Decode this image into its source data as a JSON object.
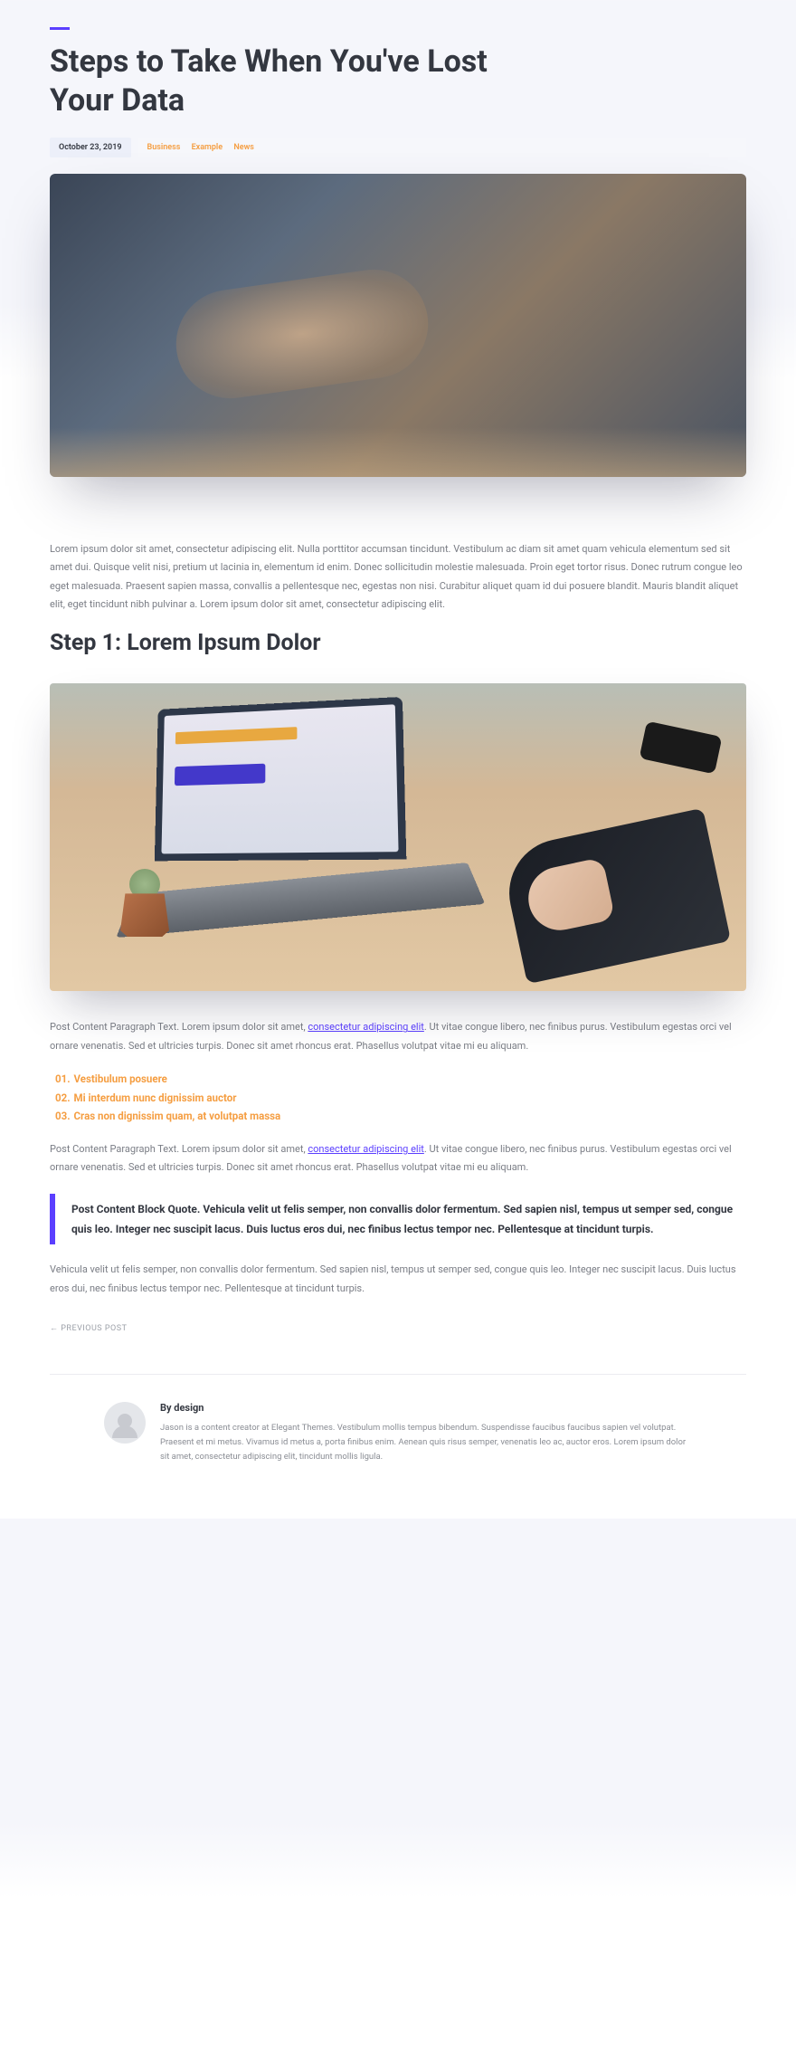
{
  "post": {
    "title": "Steps to Take When You've Lost Your Data",
    "date": "October 23, 2019",
    "categories": [
      "Business",
      "Example",
      "News"
    ],
    "intro": "Lorem ipsum dolor sit amet, consectetur adipiscing elit. Nulla porttitor accumsan tincidunt. Vestibulum ac diam sit amet quam vehicula elementum sed sit amet dui. Quisque velit nisi, pretium ut lacinia in, elementum id enim. Donec sollicitudin molestie malesuada. Proin eget tortor risus. Donec rutrum congue leo eget malesuada. Praesent sapien massa, convallis a pellentesque nec, egestas non nisi. Curabitur aliquet quam id dui posuere blandit. Mauris blandit aliquet elit, eget tincidunt nibh pulvinar a. Lorem ipsum dolor sit amet, consectetur adipiscing elit.",
    "step_heading": "Step 1: Lorem Ipsum Dolor",
    "p2_before": "Post Content Paragraph Text. Lorem ipsum dolor sit amet, ",
    "p_link": "consectetur adipiscing elit",
    "p2_after": ". Ut vitae congue libero, nec finibus purus. Vestibulum egestas orci vel ornare venenatis. Sed et ultricies turpis. Donec sit amet rhoncus erat. Phasellus volutpat vitae mi eu aliquam.",
    "list": [
      "Vestibulum posuere",
      "Mi interdum nunc dignissim auctor",
      "Cras non dignissim quam, at volutpat massa"
    ],
    "p3_before": "Post Content Paragraph Text. Lorem ipsum dolor sit amet, ",
    "p3_after": ". Ut vitae congue libero, nec finibus purus. Vestibulum egestas orci vel ornare venenatis. Sed et ultricies turpis. Donec sit amet rhoncus erat. Phasellus volutpat vitae mi eu aliquam.",
    "quote": "Post Content Block Quote. Vehicula velit ut felis semper, non convallis dolor fermentum. Sed sapien nisl, tempus ut semper sed, congue quis leo. Integer nec suscipit lacus. Duis luctus eros dui, nec finibus lectus tempor nec. Pellentesque at tincidunt turpis.",
    "p4": "Vehicula velit ut felis semper, non convallis dolor fermentum. Sed sapien nisl, tempus ut semper sed, congue quis leo. Integer nec suscipit lacus. Duis luctus eros dui, nec finibus lectus tempor nec. Pellentesque at tincidunt turpis.",
    "prev_post": "← PREVIOUS POST"
  },
  "author": {
    "byline": "By design",
    "bio": "Jason is a content creator at Elegant Themes. Vestibulum mollis tempus bibendum. Suspendisse faucibus faucibus sapien vel volutpat. Praesent et mi metus. Vivamus id metus a, porta finibus enim. Aenean quis risus semper, venenatis leo ac, auctor eros. Lorem ipsum dolor sit amet, consectetur adipiscing elit, tincidunt mollis ligula."
  }
}
